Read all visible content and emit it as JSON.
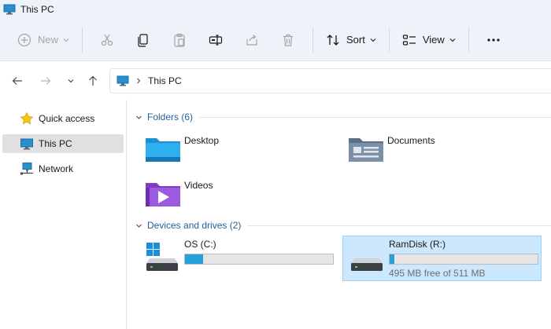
{
  "window": {
    "title": "This PC"
  },
  "toolbar": {
    "new_label": "New",
    "sort_label": "Sort",
    "view_label": "View"
  },
  "address": {
    "location": "This PC"
  },
  "sidebar": {
    "items": [
      {
        "label": "Quick access",
        "icon": "star-icon"
      },
      {
        "label": "This PC",
        "icon": "monitor-icon",
        "selected": true
      },
      {
        "label": "Network",
        "icon": "network-icon"
      }
    ]
  },
  "folders_group": {
    "header": "Folders (6)",
    "items": [
      {
        "name": "Desktop",
        "icon": "desktop-folder-icon"
      },
      {
        "name": "Documents",
        "icon": "documents-folder-icon"
      },
      {
        "name": "Videos",
        "icon": "videos-folder-icon"
      }
    ]
  },
  "drives_group": {
    "header": "Devices and drives (2)",
    "drives": [
      {
        "name": "OS (C:)",
        "used_fraction": 0.12,
        "free_text": ""
      },
      {
        "name": "RamDisk (R:)",
        "used_fraction": 0.03,
        "free_text": "495 MB free of 511 MB",
        "selected": true
      }
    ]
  },
  "colors": {
    "accent": "#1f5f9c",
    "drive_bar": "#26a0da",
    "selection": "#cce8ff"
  }
}
